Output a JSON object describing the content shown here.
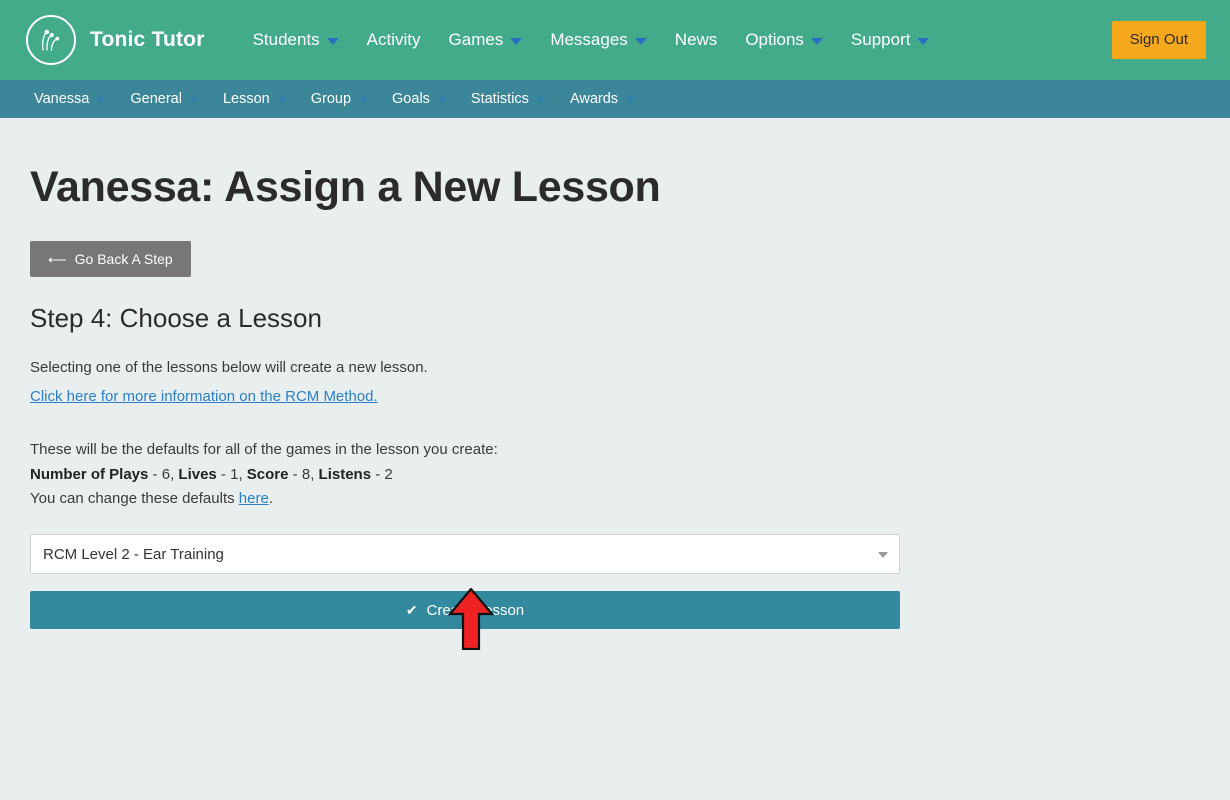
{
  "header": {
    "brand": "Tonic Tutor",
    "logo_icon": "tonic-tutor-circle-logo",
    "nav": [
      {
        "label": "Students",
        "caret": true
      },
      {
        "label": "Activity",
        "caret": false
      },
      {
        "label": "Games",
        "caret": true
      },
      {
        "label": "Messages",
        "caret": true
      },
      {
        "label": "News",
        "caret": false
      },
      {
        "label": "Options",
        "caret": true
      },
      {
        "label": "Support",
        "caret": true
      }
    ],
    "sign_out": "Sign Out",
    "bar_color": "#43ab8a",
    "sign_out_color": "#f5a81c",
    "caret_color": "#2a6ec2"
  },
  "subnav": {
    "bar_color": "#3c8699",
    "items": [
      {
        "label": "Vanessa",
        "caret": true
      },
      {
        "label": "General",
        "caret": true
      },
      {
        "label": "Lesson",
        "caret": true
      },
      {
        "label": "Group",
        "caret": true
      },
      {
        "label": "Goals",
        "caret": true
      },
      {
        "label": "Statistics",
        "caret": true
      },
      {
        "label": "Awards",
        "caret": true
      }
    ]
  },
  "main": {
    "page_title": "Vanessa: Assign a New Lesson",
    "go_back_label": "Go Back A Step",
    "go_back_icon": "arrow-left-icon",
    "step_heading": "Step 4: Choose a Lesson",
    "intro_text": "Selecting one of the lessons below will create a new lesson.",
    "rcm_link": "Click here for more information on the RCM Method.",
    "defaults_intro": "These will be the defaults for all of the games in the lesson you create:",
    "defaults": [
      {
        "name": "Number of Plays",
        "value": "6"
      },
      {
        "name": "Lives",
        "value": "1"
      },
      {
        "name": "Score",
        "value": "8"
      },
      {
        "name": "Listens",
        "value": "2"
      }
    ],
    "change_defaults_prefix": "You can change these defaults ",
    "change_defaults_link": "here",
    "change_defaults_suffix": ".",
    "lesson_select_value": "RCM Level 2 - Ear Training",
    "create_button_label": "Create Lesson",
    "create_button_icon": "check-icon",
    "create_button_color": "#338a9e",
    "annotation_arrow": {
      "icon": "red-up-arrow-annotation",
      "fill": "#ee2222",
      "stroke": "#111111",
      "points_at": "Create Lesson"
    }
  },
  "page": {
    "background": "#e8efee"
  }
}
